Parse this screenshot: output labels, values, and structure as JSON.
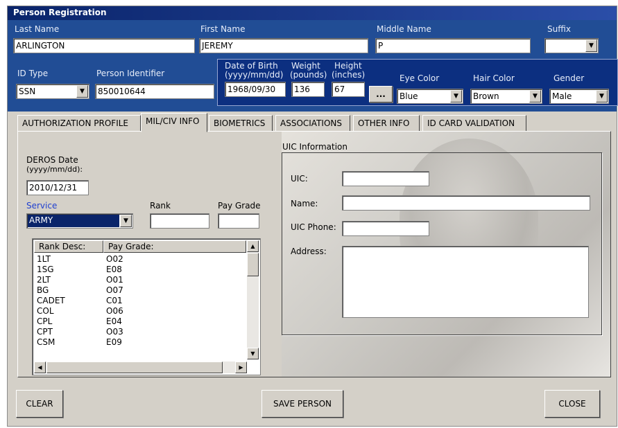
{
  "window": {
    "title": "Person Registration"
  },
  "person": {
    "last_name_label": "Last Name",
    "last_name": "ARLINGTON",
    "first_name_label": "First Name",
    "first_name": "JEREMY",
    "middle_name_label": "Middle Name",
    "middle_name": "P",
    "suffix_label": "Suffix",
    "suffix": "",
    "id_type_label": "ID Type",
    "id_type": "SSN",
    "person_identifier_label": "Person Identifier",
    "person_identifier": "850010644",
    "dob_label_1": "Date of Birth",
    "dob_label_2": "(yyyy/mm/dd)",
    "dob": "1968/09/30",
    "weight_label_1": "Weight",
    "weight_label_2": "(pounds)",
    "weight": "136",
    "height_label_1": "Height",
    "height_label_2": "(inches)",
    "height": "67",
    "more_button": "...",
    "eye_color_label": "Eye Color",
    "eye_color": "Blue",
    "hair_color_label": "Hair Color",
    "hair_color": "Brown",
    "gender_label": "Gender",
    "gender": "Male"
  },
  "tabs": [
    {
      "label": "AUTHORIZATION PROFILE"
    },
    {
      "label": "MIL/CIV INFO"
    },
    {
      "label": "BIOMETRICS"
    },
    {
      "label": "ASSOCIATIONS"
    },
    {
      "label": "OTHER INFO"
    },
    {
      "label": "ID CARD VALIDATION"
    }
  ],
  "milciv": {
    "deros_label_1": "DEROS Date",
    "deros_label_2": "(yyyy/mm/dd):",
    "deros": "2010/12/31",
    "service_label": "Service",
    "service": "ARMY",
    "rank_label": "Rank",
    "rank": "",
    "pay_grade_label": "Pay Grade",
    "pay_grade": "",
    "list_headers": [
      "Rank Desc:",
      "Pay Grade:"
    ],
    "rows": [
      [
        "1LT",
        "O02"
      ],
      [
        "1SG",
        "E08"
      ],
      [
        "2LT",
        "O01"
      ],
      [
        "BG",
        "O07"
      ],
      [
        "CADET",
        "C01"
      ],
      [
        "COL",
        "O06"
      ],
      [
        "CPL",
        "E04"
      ],
      [
        "CPT",
        "O03"
      ],
      [
        "CSM",
        "E09"
      ]
    ]
  },
  "uic": {
    "group_label": "UIC Information",
    "uic_label": "UIC:",
    "uic": "",
    "name_label": "Name:",
    "name": "",
    "phone_label": "UIC Phone:",
    "phone": "",
    "address_label": "Address:",
    "address": ""
  },
  "buttons": {
    "clear": "CLEAR",
    "save": "SAVE PERSON",
    "close": "CLOSE"
  },
  "colors": {
    "header_bg": "#214d95",
    "dob_box_bg": "#0c2f80",
    "service_label": "#1f3fd0"
  }
}
